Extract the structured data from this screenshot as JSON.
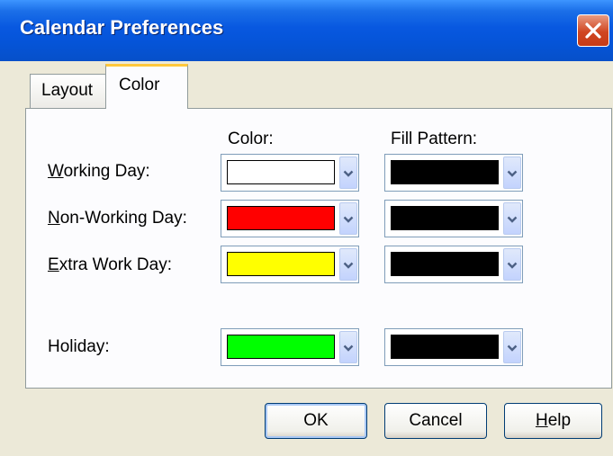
{
  "window": {
    "title": "Calendar Preferences",
    "close_icon": "close-icon"
  },
  "tabs": [
    {
      "label": "Layout",
      "selected": false
    },
    {
      "label": "Color",
      "selected": true
    }
  ],
  "headers": {
    "color": "Color:",
    "fill_pattern": "Fill Pattern:"
  },
  "rows": [
    {
      "label_mnemonic": "W",
      "label_rest": "orking Day:",
      "color": "#ffffff",
      "fill": "#000000"
    },
    {
      "label_mnemonic": "N",
      "label_rest": "on-Working Day:",
      "color": "#ff0000",
      "fill": "#000000"
    },
    {
      "label_mnemonic": "E",
      "label_rest": "xtra Work Day:",
      "color": "#ffff00",
      "fill": "#000000"
    },
    {
      "label": "Holiday:",
      "color": "#00ff00",
      "fill": "#000000"
    }
  ],
  "buttons": {
    "ok": "OK",
    "cancel": "Cancel",
    "help_mnemonic": "H",
    "help_rest": "elp"
  },
  "colors": {
    "titlebar": "#0858e0",
    "dialog_bg": "#ece9d8",
    "panel_bg": "#fcfcfe",
    "tab_highlight": "#ffc83c",
    "close_button": "#d04621"
  }
}
